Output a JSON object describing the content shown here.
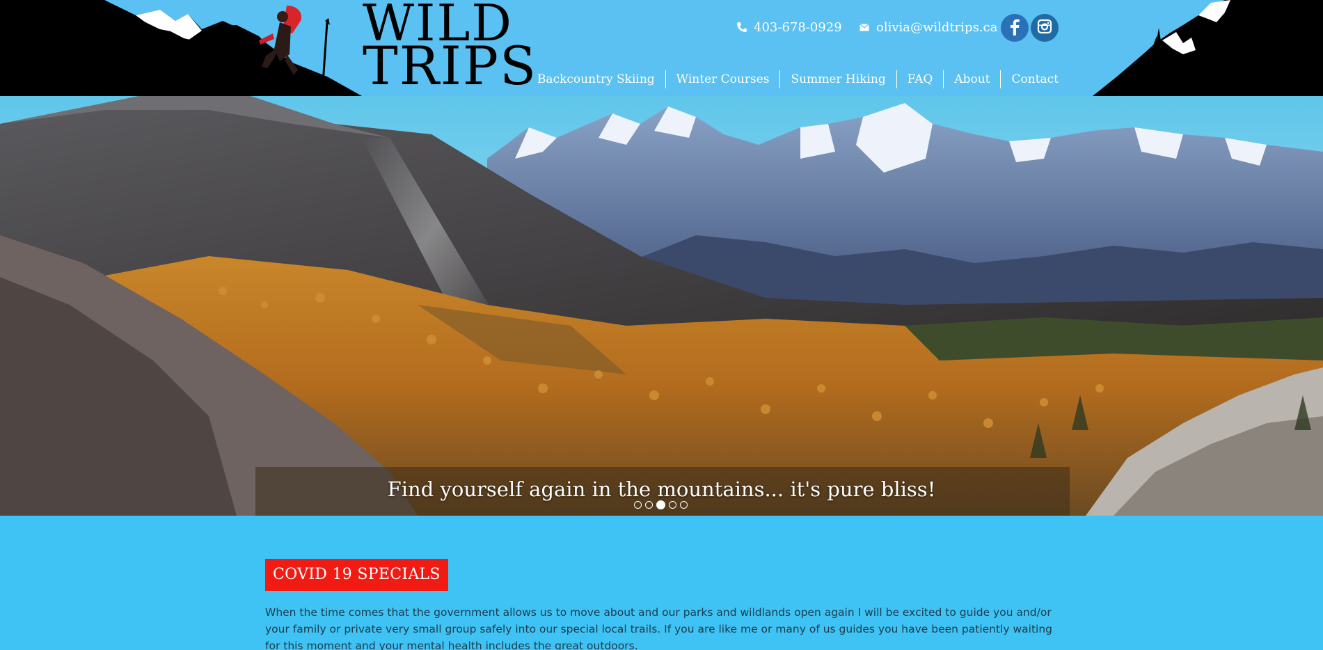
{
  "brand": {
    "logo_line1": "WILD",
    "logo_line2": "TRIPS",
    "colors": {
      "sky": "#5ac1f2",
      "content_bg": "#3fc3f4",
      "badge": "#f11b14",
      "facebook": "#2a71b8",
      "instagram": "#1f6ba6"
    }
  },
  "contact": {
    "phone": "403-678-0929",
    "email": "olivia@wildtrips.ca",
    "phone_icon": "phone-icon",
    "email_icon": "envelope-icon"
  },
  "social": [
    {
      "name": "facebook",
      "icon": "facebook-icon"
    },
    {
      "name": "instagram",
      "icon": "instagram-icon"
    }
  ],
  "nav": {
    "items": [
      {
        "label": "Backcountry Skiing"
      },
      {
        "label": "Winter Courses"
      },
      {
        "label": "Summer Hiking"
      },
      {
        "label": "FAQ"
      },
      {
        "label": "About"
      },
      {
        "label": "Contact"
      }
    ]
  },
  "hero": {
    "caption": "Find yourself again in the mountains... it's pure bliss!",
    "slides_total": 5,
    "active_slide": 3
  },
  "main": {
    "badge": "COVID 19 SPECIALS",
    "paragraph": "When the time comes that the government allows us to move about and our parks and wildlands open again I will be excited to guide you and/or your family or private very small group safely into our special local trails.  If you are like me or many of us guides you have been patiently waiting for this moment and your mental health includes the great outdoors."
  }
}
